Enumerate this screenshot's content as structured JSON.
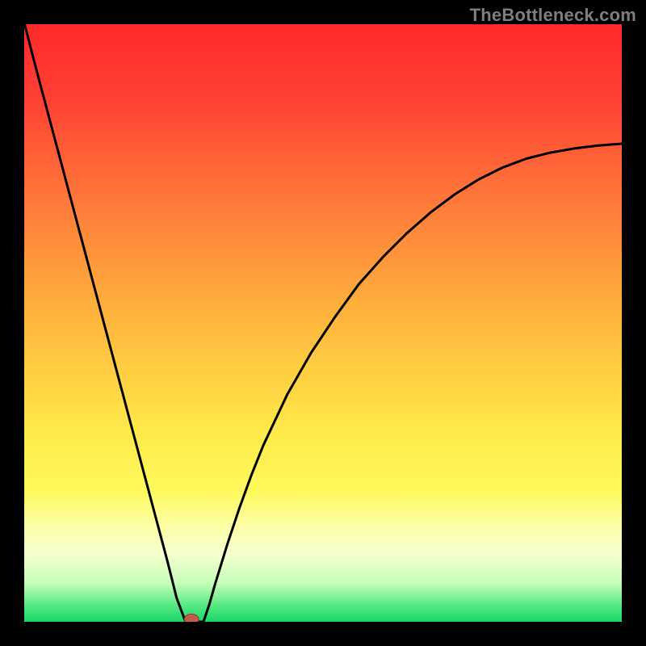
{
  "watermark": "TheBottleneck.com",
  "colors": {
    "frame_bg": "#000000",
    "curve": "#000000",
    "marker_fill": "#c55a4a",
    "marker_stroke": "#8a3b30",
    "gradient_stops": [
      {
        "offset": 0.0,
        "color": "#ff2a2a"
      },
      {
        "offset": 0.12,
        "color": "#ff3f33"
      },
      {
        "offset": 0.3,
        "color": "#ff7a3a"
      },
      {
        "offset": 0.5,
        "color": "#ffb83d"
      },
      {
        "offset": 0.68,
        "color": "#ffe94a"
      },
      {
        "offset": 0.78,
        "color": "#fff95c"
      },
      {
        "offset": 0.835,
        "color": "#fdffa0"
      },
      {
        "offset": 0.885,
        "color": "#f7ffd0"
      },
      {
        "offset": 0.935,
        "color": "#c6ffb9"
      },
      {
        "offset": 0.975,
        "color": "#4fe87f"
      },
      {
        "offset": 1.0,
        "color": "#1ad66a"
      }
    ]
  },
  "chart_data": {
    "type": "line",
    "title": "",
    "xlabel": "",
    "ylabel": "",
    "xlim": [
      0,
      100
    ],
    "ylim": [
      0,
      100
    ],
    "x": [
      0,
      2,
      4,
      6,
      8,
      10,
      12,
      14,
      16,
      18,
      20,
      22,
      24,
      25.5,
      27,
      30,
      31,
      32,
      34,
      36,
      38,
      40,
      44,
      48,
      52,
      56,
      60,
      64,
      68,
      72,
      76,
      80,
      84,
      88,
      92,
      96,
      100
    ],
    "values": [
      100,
      92.5,
      85,
      77.5,
      70,
      62.5,
      55,
      47.5,
      40,
      32.5,
      25,
      17.5,
      10,
      4,
      0,
      0,
      3,
      6.5,
      13,
      19,
      24.5,
      29.5,
      38,
      45,
      51,
      56.5,
      61,
      65,
      68.5,
      71.5,
      74,
      76,
      77.5,
      78.5,
      79.2,
      79.7,
      80
    ],
    "marker": {
      "x": 28,
      "y": 0,
      "rx": 1.2,
      "ry": 0.9
    },
    "note": "values are bottleneck percentage (0 = optimal green, 100 = red); curve dips to zero near x≈28 then rises asymptotically toward ~80"
  }
}
